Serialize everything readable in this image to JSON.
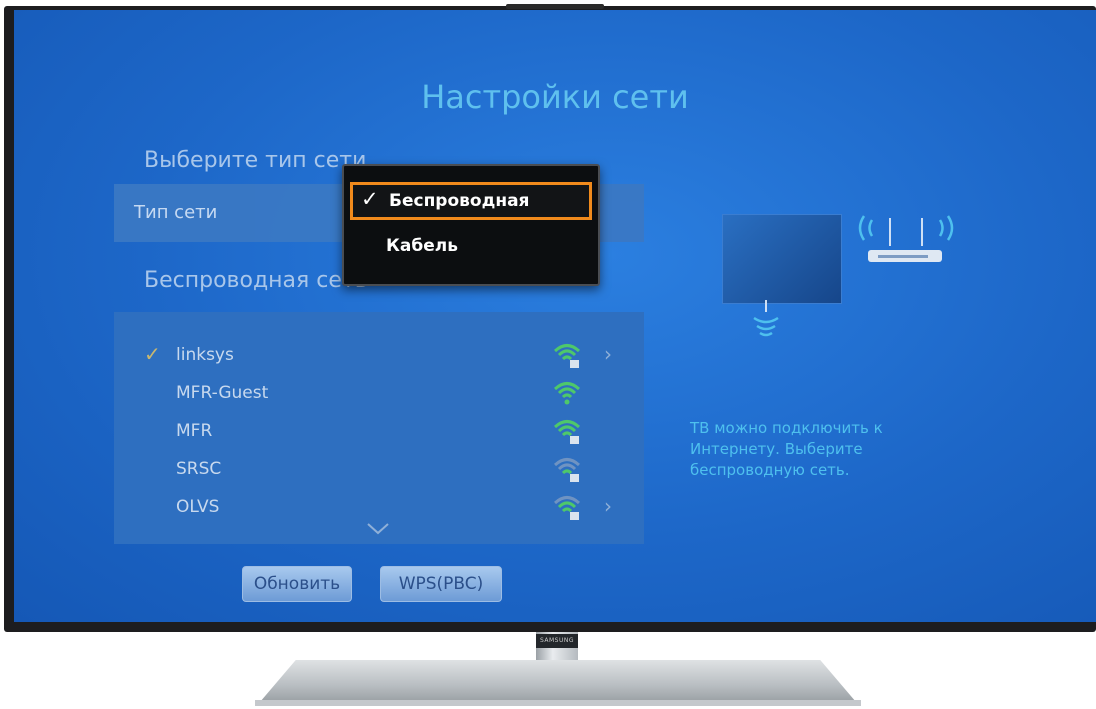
{
  "screen": {
    "title": "Настройки сети",
    "network_type_section": {
      "heading": "Выберите тип сети",
      "row_label": "Тип сети"
    },
    "wireless_section": {
      "heading": "Беспроводная сеть",
      "networks": [
        {
          "name": "linksys",
          "selected": true,
          "has_arrow": true,
          "signal_icon": "wifi-locked-strong-icon"
        },
        {
          "name": "MFR-Guest",
          "selected": false,
          "has_arrow": false,
          "signal_icon": "wifi-strong-icon"
        },
        {
          "name": "MFR",
          "selected": false,
          "has_arrow": false,
          "signal_icon": "wifi-locked-strong-icon"
        },
        {
          "name": "SRSC",
          "selected": false,
          "has_arrow": false,
          "signal_icon": "wifi-locked-weak-icon"
        },
        {
          "name": "OLVS",
          "selected": false,
          "has_arrow": true,
          "signal_icon": "wifi-locked-medium-icon"
        }
      ]
    },
    "buttons": {
      "refresh": "Обновить",
      "wps": "WPS(PBC)"
    },
    "dropdown": {
      "options": [
        {
          "label": "Беспроводная",
          "selected": true
        },
        {
          "label": "Кабель",
          "selected": false
        }
      ]
    },
    "description": "ТВ можно подключить к Интернету. Выберите беспроводную сеть."
  },
  "brand": {
    "logo": "SAMSUNG"
  },
  "colors": {
    "screen_bg": "#1d67c8",
    "title": "#5fc0ee",
    "focus_border": "#f08a1c",
    "description": "#4ec0ee"
  }
}
